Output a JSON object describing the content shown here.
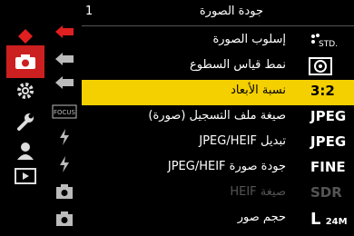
{
  "header": {
    "title": "جودة الصورة",
    "page": "1"
  },
  "left_tabs": [
    {
      "name": "rec-submenu-icon",
      "active": false
    },
    {
      "name": "camera-icon",
      "active": true
    },
    {
      "name": "gear-icon",
      "active": false
    },
    {
      "name": "wrench-icon",
      "active": false
    },
    {
      "name": "person-icon",
      "active": false
    },
    {
      "name": "playback-icon",
      "active": false
    }
  ],
  "sub_tabs": [
    {
      "name": "photo-quality-subtab-icon",
      "active": true
    },
    {
      "name": "subtab-2-icon",
      "active": false
    },
    {
      "name": "subtab-3-icon",
      "active": false
    },
    {
      "name": "focus-subtab-icon",
      "active": false,
      "text": "FOCUS"
    },
    {
      "name": "flash-subtab-icon",
      "active": false
    },
    {
      "name": "flash2-subtab-icon",
      "active": false
    },
    {
      "name": "camera-subtab-icon",
      "active": false
    },
    {
      "name": "camera2-subtab-icon",
      "active": false
    }
  ],
  "rows": [
    {
      "label": "إسلوب الصورة",
      "value": "STD.",
      "type": "icon"
    },
    {
      "label": "نمط قياس السطوع",
      "value": "",
      "type": "metering-icon"
    },
    {
      "label": "نسبة الأبعاد",
      "value": "3:2",
      "type": "text",
      "selected": true
    },
    {
      "label": "صيغة ملف التسجيل (صورة)",
      "value": "JPEG",
      "type": "text"
    },
    {
      "label": "تبديل JPEG/HEIF",
      "value": "JPEG",
      "type": "text"
    },
    {
      "label": "جودة صورة JPEG/HEIF",
      "value": "FINE",
      "type": "text"
    },
    {
      "label": "صيغة HEIF",
      "value": "SDR",
      "type": "text",
      "disabled": true
    },
    {
      "label": "حجم صور",
      "value": "L",
      "value_suffix": "24M",
      "type": "size"
    }
  ],
  "colors": {
    "selected_bg": "#f5d000",
    "active_tab": "#cc1f1f",
    "accent_red": "#e02020"
  }
}
